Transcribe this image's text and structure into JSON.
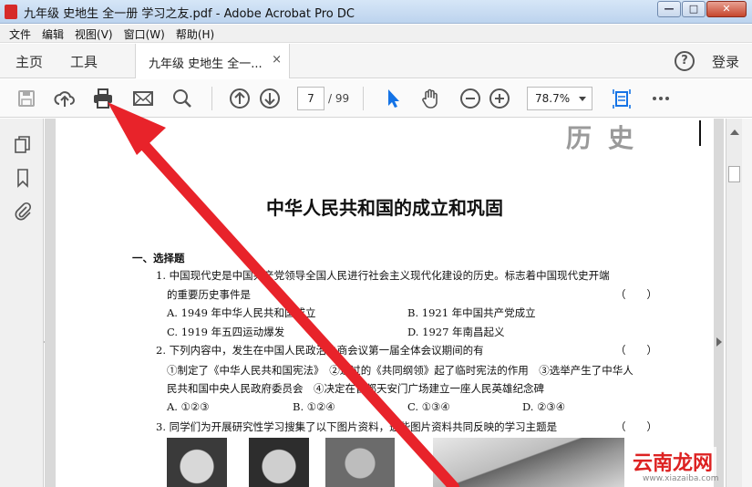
{
  "window": {
    "title": "九年级 史地生 全一册 学习之友.pdf - Adobe Acrobat Pro DC",
    "minimize": "—",
    "maximize": "□",
    "close": "✕"
  },
  "menu": [
    "文件",
    "编辑",
    "视图(V)",
    "窗口(W)",
    "帮助(H)"
  ],
  "tabs": {
    "home": "主页",
    "tools": "工具",
    "document": "九年级 史地生 全一...",
    "close": "×",
    "login": "登录",
    "help": "?"
  },
  "toolbar": {
    "current_page": "7",
    "total_pages": "/ 99",
    "zoom": "78.7%"
  },
  "document": {
    "subject": "历史",
    "title": "中华人民共和国的成立和巩固",
    "section": "一、选择题",
    "lines": [
      "1. 中国现代史是中国共产党领导全国人民进行社会主义现代化建设的历史。标志着中国现代史开端",
      "的重要历史事件是",
      "（　　）",
      "A. 1949 年中华人民共和国成立",
      "B. 1921 年中国共产党成立",
      "C. 1919 年五四运动爆发",
      "D. 1927 年南昌起义",
      "2. 下列内容中，发生在中国人民政治协商会议第一届全体会议期间的有",
      "（　　）",
      "①制定了《中华人民共和国宪法》　②通过的《共同纲领》起了临时宪法的作用　③选举产生了中华人",
      "民共和国中央人民政府委员会　④决定在首都天安门广场建立一座人民英雄纪念碑",
      "A. ①②③",
      "B. ①②④",
      "C. ①③④",
      "D. ②③④",
      "3. 同学们为开展研究性学习搜集了以下图片资料，这些图片资料共同反映的学习主题是",
      "（　　）"
    ]
  },
  "watermark": {
    "text": "云南龙网",
    "url": "www.xiazaiba.com"
  },
  "colors": {
    "arrow": "#e8232a",
    "acrobat_red": "#d62a2a",
    "select_blue": "#1473e6"
  }
}
